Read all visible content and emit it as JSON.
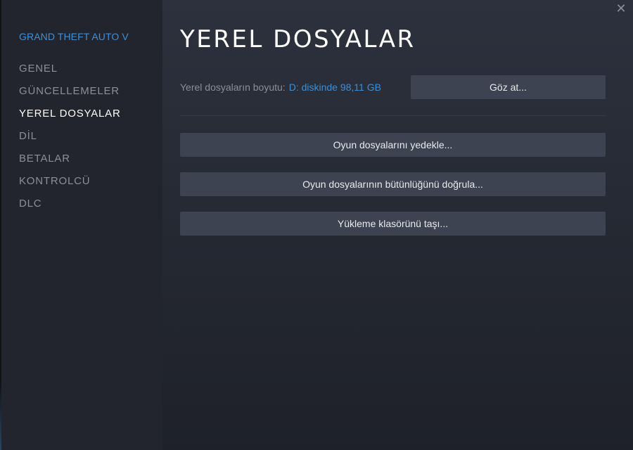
{
  "sidebar": {
    "game_title": "GRAND THEFT AUTO V",
    "items": [
      {
        "label": "GENEL"
      },
      {
        "label": "GÜNCELLEMELER"
      },
      {
        "label": "YEREL DOSYALAR"
      },
      {
        "label": "DİL"
      },
      {
        "label": "BETALAR"
      },
      {
        "label": "KONTROLCÜ"
      },
      {
        "label": "DLC"
      }
    ],
    "active_index": 2
  },
  "main": {
    "title": "YEREL DOSYALAR",
    "size_label": "Yerel dosyaların boyutu:",
    "size_value": "D: diskinde 98,11 GB",
    "browse_label": "Göz at...",
    "actions": [
      {
        "label": "Oyun dosyalarını yedekle..."
      },
      {
        "label": "Oyun dosyalarının bütünlüğünü doğrula..."
      },
      {
        "label": "Yükleme klasörünü taşı..."
      }
    ]
  },
  "window": {
    "close_icon": "close-icon"
  },
  "colors": {
    "accent": "#3d8fd8",
    "sidebar_bg": "#22252e",
    "button_bg": "#3d4350",
    "muted_text": "#8a8f98"
  }
}
